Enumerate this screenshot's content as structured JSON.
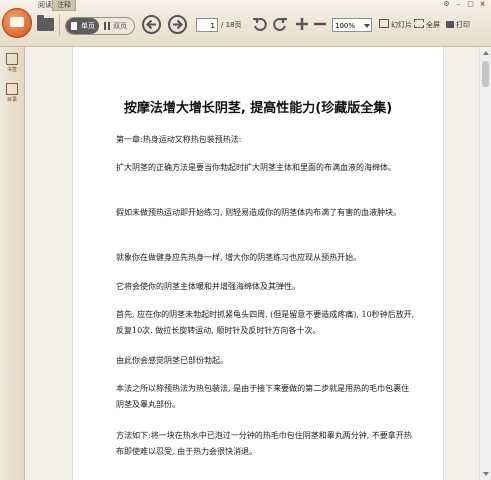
{
  "menu": {
    "read": "阅读",
    "annotate": "注释"
  },
  "toolbar": {
    "single_page": "单页",
    "double_page": "双页",
    "page_current": "1",
    "page_total": "/ 18页",
    "zoom": "100%",
    "slideshow": "幻灯片",
    "fullscreen": "全屏",
    "print": "打印"
  },
  "sidebar": {
    "bookmark": "书签",
    "outline": "目录"
  },
  "document": {
    "title": "按摩法增大增长阴茎, 提高性能力(珍藏版全集)",
    "paragraphs": [
      "第一章:热身运动又称热包装预热法:",
      "扩大阴茎的正确方法是要当你勃起时扩大阴茎主体和里面的布满血液的海绵体。",
      "假如未做预热运动即开始练习, 则轻易造成你的阴茎体内布满了有害的血液肿块。",
      "就象你在做健身应先热身一样, 增大你的阴茎练习也应现从预热开始。",
      "它将会使你的阴茎主体暖和并增强海绵体及其弹性。",
      "首先, 应在你的阴茎未勃起时抓紧龟头四周, (但是留意不要造成疼痛), 10秒钟后放开, 反复10次. 做拉长旋转运动, 顺时针及反时针方向各十次。",
      "由此你会感觉阴茎已部份勃起。",
      "本法之所以称预热法为热包装法, 是由于接下来要做的第二步就是用热的毛巾包裹住阴茎及睾丸部份。",
      "方法如下:将一块在热水中已泡过一分钟的热毛巾包住阴茎和睾丸两分钟, 不要拿开热布即使难以忍受, 由于热力会很快消退。"
    ]
  },
  "colors": {
    "toolbar_bg": "#e6dcc8",
    "logo": "#d0501e",
    "accent_text": "#7a4a30"
  }
}
